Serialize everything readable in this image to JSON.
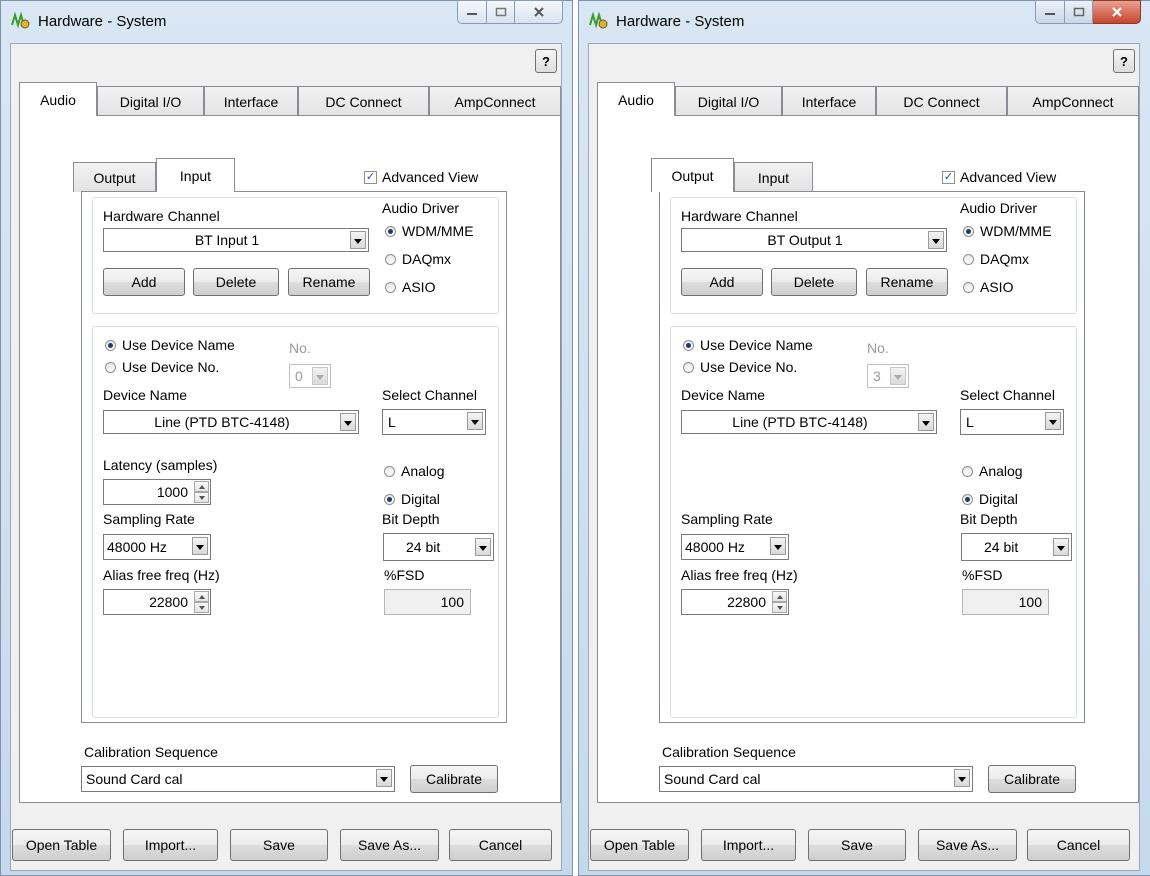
{
  "windows": [
    {
      "title": "Hardware - System",
      "help_label": "?",
      "main_tabs": [
        "Audio",
        "Digital I/O",
        "Interface",
        "DC Connect",
        "AmpConnect"
      ],
      "active_main_tab": "Audio",
      "sub_tabs": [
        "Output",
        "Input"
      ],
      "active_sub_tab": "Input",
      "advanced_view": {
        "label": "Advanced View",
        "checked": true
      },
      "hardware_channel": {
        "label": "Hardware Channel",
        "value": "BT Input 1"
      },
      "channel_buttons": {
        "add": "Add",
        "delete": "Delete",
        "rename": "Rename"
      },
      "audio_driver": {
        "label": "Audio Driver",
        "options": [
          "WDM/MME",
          "DAQmx",
          "ASIO"
        ],
        "selected": "WDM/MME"
      },
      "device_mode": {
        "options": [
          "Use Device Name",
          "Use Device No."
        ],
        "selected": "Use Device Name"
      },
      "device_no": {
        "label": "No.",
        "value": "0"
      },
      "device_name": {
        "label": "Device Name",
        "value": "Line (PTD BTC-4148)"
      },
      "select_channel": {
        "label": "Select Channel",
        "value": "L"
      },
      "latency": {
        "label": "Latency (samples)",
        "value": "1000"
      },
      "signal_type": {
        "options": [
          "Analog",
          "Digital"
        ],
        "selected": "Digital"
      },
      "sampling_rate": {
        "label": "Sampling Rate",
        "value": "48000 Hz"
      },
      "bit_depth": {
        "label": "Bit Depth",
        "value": "24 bit"
      },
      "alias_free": {
        "label": "Alias free freq (Hz)",
        "value": "22800"
      },
      "fsd": {
        "label": "%FSD",
        "value": "100"
      },
      "calibration": {
        "label": "Calibration Sequence",
        "value": "Sound Card cal",
        "button": "Calibrate"
      },
      "footer_buttons": {
        "open_table": "Open Table",
        "import": "Import...",
        "save": "Save",
        "save_as": "Save As...",
        "cancel": "Cancel"
      }
    },
    {
      "title": "Hardware - System",
      "help_label": "?",
      "main_tabs": [
        "Audio",
        "Digital I/O",
        "Interface",
        "DC Connect",
        "AmpConnect"
      ],
      "active_main_tab": "Audio",
      "sub_tabs": [
        "Output",
        "Input"
      ],
      "active_sub_tab": "Output",
      "advanced_view": {
        "label": "Advanced View",
        "checked": true
      },
      "hardware_channel": {
        "label": "Hardware Channel",
        "value": "BT Output 1"
      },
      "channel_buttons": {
        "add": "Add",
        "delete": "Delete",
        "rename": "Rename"
      },
      "audio_driver": {
        "label": "Audio Driver",
        "options": [
          "WDM/MME",
          "DAQmx",
          "ASIO"
        ],
        "selected": "WDM/MME"
      },
      "device_mode": {
        "options": [
          "Use Device Name",
          "Use Device No."
        ],
        "selected": "Use Device Name"
      },
      "device_no": {
        "label": "No.",
        "value": "3"
      },
      "device_name": {
        "label": "Device Name",
        "value": "Line (PTD BTC-4148)"
      },
      "select_channel": {
        "label": "Select Channel",
        "value": "L"
      },
      "signal_type": {
        "options": [
          "Analog",
          "Digital"
        ],
        "selected": "Digital"
      },
      "sampling_rate": {
        "label": "Sampling Rate",
        "value": "48000 Hz"
      },
      "bit_depth": {
        "label": "Bit Depth",
        "value": "24 bit"
      },
      "alias_free": {
        "label": "Alias free freq (Hz)",
        "value": "22800"
      },
      "fsd": {
        "label": "%FSD",
        "value": "100"
      },
      "calibration": {
        "label": "Calibration Sequence",
        "value": "Sound Card cal",
        "button": "Calibrate"
      },
      "footer_buttons": {
        "open_table": "Open Table",
        "import": "Import...",
        "save": "Save",
        "save_as": "Save As...",
        "cancel": "Cancel"
      }
    }
  ]
}
